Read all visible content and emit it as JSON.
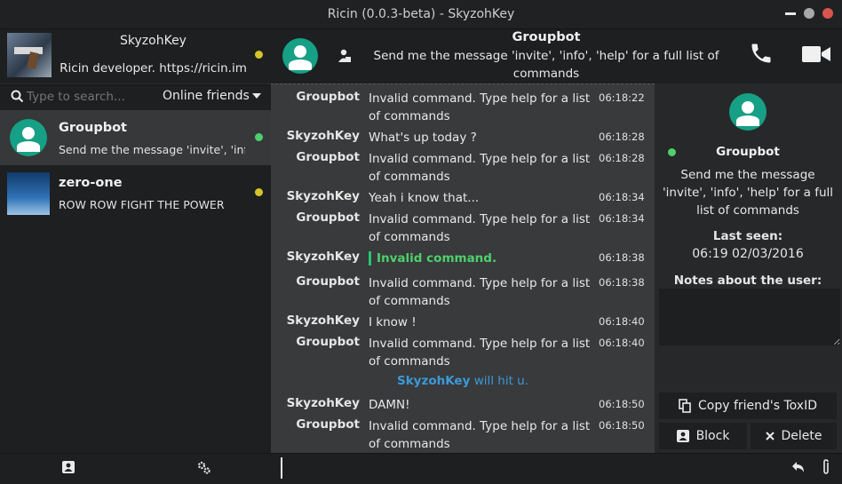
{
  "window": {
    "title": "Ricin (0.0.3-beta) - SkyzohKey"
  },
  "profile": {
    "name": "SkyzohKey",
    "status_message": "Ricin developer. https://ricin.im"
  },
  "search": {
    "placeholder": "Type to search...",
    "filter": "Online friends"
  },
  "friends": [
    {
      "name": "Groupbot",
      "status": "Send me the message 'invite', 'inf...",
      "presence": "online"
    },
    {
      "name": "zero-one",
      "status": "ROW ROW FIGHT THE POWER",
      "presence": "away"
    }
  ],
  "chat_header": {
    "name": "Groupbot",
    "status": "Send me the message 'invite', 'info', 'help' for a full list of commands"
  },
  "messages": [
    {
      "author": "Groupbot",
      "text": "Invalid command. Type help for a list of commands",
      "time": "06:18:22"
    },
    {
      "author": "SkyzohKey",
      "text": "What's up today ?",
      "time": "06:18:28"
    },
    {
      "author": "Groupbot",
      "text": "Invalid command. Type help for a list of commands",
      "time": "06:18:28"
    },
    {
      "author": "SkyzohKey",
      "text": "Yeah i know that...",
      "time": "06:18:34"
    },
    {
      "author": "Groupbot",
      "text": "Invalid command. Type help for a list of commands",
      "time": "06:18:34"
    },
    {
      "author": "SkyzohKey",
      "text": "Invalid command.",
      "time": "06:18:38",
      "quote": true
    },
    {
      "author": "Groupbot",
      "text": "Invalid command. Type help for a list of commands",
      "time": "06:18:38"
    },
    {
      "author": "SkyzohKey",
      "text": "I know !",
      "time": "06:18:40"
    },
    {
      "author": "Groupbot",
      "text": "Invalid command. Type help for a list of commands",
      "time": "06:18:40"
    },
    {
      "author": "SkyzohKey",
      "text": "DAMN!",
      "time": "06:18:50"
    },
    {
      "author": "Groupbot",
      "text": "Invalid command. Type help for a list of commands",
      "time": "06:18:50"
    }
  ],
  "action": {
    "name": "SkyzohKey",
    "text": " will hit u."
  },
  "friend_info": {
    "name": "Groupbot",
    "status": "Send me the message 'invite', 'info', 'help' for a full list of commands",
    "last_seen_label": "Last seen:",
    "last_seen": "06:19 02/03/2016",
    "notes_label": "Notes about the user:",
    "copy_toxid": "Copy friend's ToxID",
    "block": "Block",
    "delete": "Delete"
  },
  "colors": {
    "accent": "#16a085",
    "online": "#4ed06c",
    "away": "#d6c52a",
    "action": "#3d9ad8"
  }
}
